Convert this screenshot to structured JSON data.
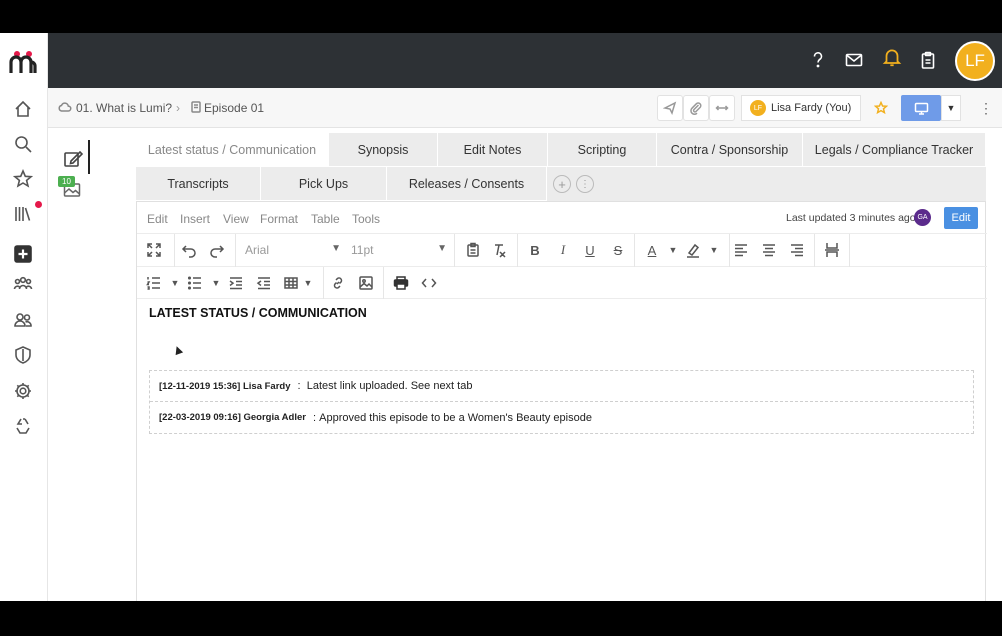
{
  "app": {
    "avatar_initials": "LF",
    "accent_color": "#f2b01e"
  },
  "breadcrumb": {
    "project": "01. What is Lumi?",
    "episode": "Episode 01"
  },
  "header_actions": {
    "user_chip_initials": "LF",
    "user_chip_label": "Lisa Fardy (You)"
  },
  "sidetools": {
    "badge_count": "10"
  },
  "tabs": {
    "row1": [
      "Latest status / Communication",
      "Synopsis",
      "Edit Notes",
      "Scripting",
      "Contra / Sponsorship",
      "Legals / Compliance Tracker"
    ],
    "row2": [
      "Transcripts",
      "Pick Ups",
      "Releases / Consents"
    ]
  },
  "editor": {
    "menu": [
      "Edit",
      "Insert",
      "View",
      "Format",
      "Table",
      "Tools"
    ],
    "last_updated": "Last updated 3 minutes ago",
    "editor_initials": "GA",
    "edit_button": "Edit",
    "font_family": "Arial",
    "font_size": "11pt"
  },
  "document": {
    "title": "LATEST STATUS / COMMUNICATION",
    "entries": [
      {
        "meta": "[12-11-2019 15:36] Lisa Fardy",
        "sep": " :  ",
        "text": "Latest link uploaded. See next tab"
      },
      {
        "meta": "[22-03-2019 09:16] Georgia Adler",
        "sep": " : ",
        "text": "Approved this episode to be a Women's Beauty episode"
      }
    ]
  }
}
